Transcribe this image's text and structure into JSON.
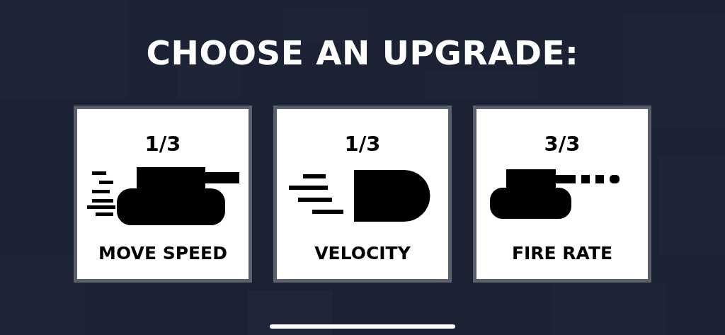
{
  "title": "CHOOSE AN UPGRADE:",
  "upgrades": [
    {
      "kind": "move",
      "level": "1/3",
      "name": "MOVE SPEED"
    },
    {
      "kind": "velocity",
      "level": "1/3",
      "name": "VELOCITY"
    },
    {
      "kind": "fire",
      "level": "3/3",
      "name": "FIRE RATE"
    }
  ]
}
